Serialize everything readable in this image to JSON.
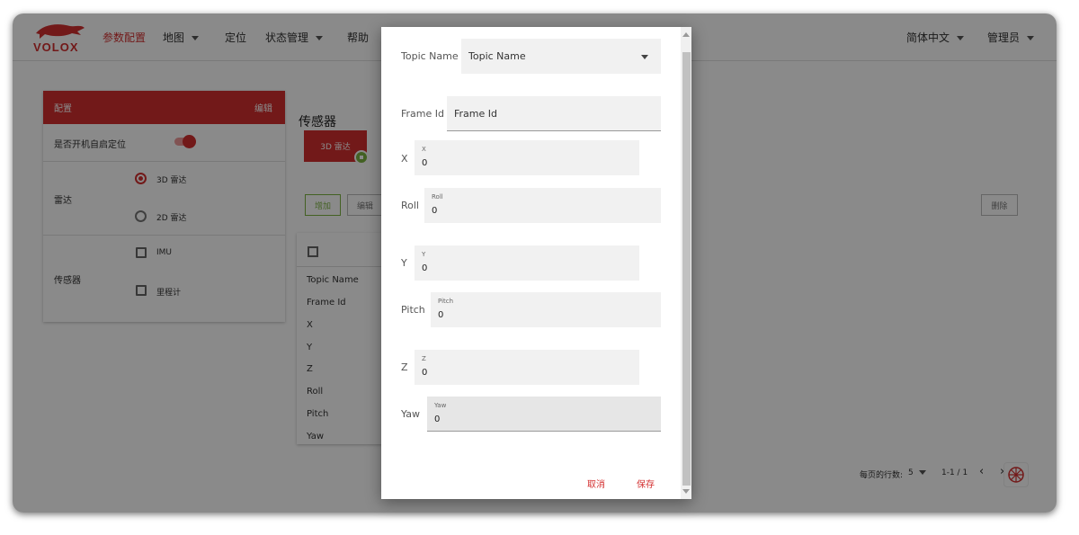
{
  "nav": {
    "logo_text": "VOLOX",
    "items": [
      {
        "label": "参数配置",
        "active": true
      },
      {
        "label": "地图",
        "dropdown": true
      },
      {
        "label": "定位"
      },
      {
        "label": "状态管理",
        "dropdown": true
      },
      {
        "label": "帮助"
      }
    ],
    "language": "简体中文",
    "user": "管理员"
  },
  "left_panel": {
    "header_title": "配置",
    "header_action": "编辑",
    "autostart_label": "是否开机自启定位",
    "autostart_on": true,
    "lidar_label": "雷达",
    "lidar_options": [
      "3D 雷达",
      "2D 雷达"
    ],
    "lidar_selected": "3D 雷达",
    "sensor_label": "传感器",
    "sensor_options": [
      "IMU",
      "里程计"
    ]
  },
  "main": {
    "title": "传感器",
    "tab_label": "3D 雷达",
    "add_button": "增加",
    "edit_button": "编辑",
    "delete_button": "删除",
    "table_rows": [
      "Topic Name",
      "Frame Id",
      "X",
      "Y",
      "Z",
      "Roll",
      "Pitch",
      "Yaw"
    ],
    "pagination": {
      "rows_per_page_label": "每页的行数:",
      "rows_per_page": "5",
      "range": "1-1 / 1"
    }
  },
  "dialog": {
    "topic_name": {
      "label": "Topic Name",
      "value": "Topic Name"
    },
    "frame_id": {
      "label": "Frame Id",
      "value": "Frame Id"
    },
    "x": {
      "label": "X",
      "hint": "X",
      "value": "0"
    },
    "roll": {
      "label": "Roll",
      "hint": "Roll",
      "value": "0"
    },
    "y": {
      "label": "Y",
      "hint": "Y",
      "value": "0"
    },
    "pitch": {
      "label": "Pitch",
      "hint": "Pitch",
      "value": "0"
    },
    "z": {
      "label": "Z",
      "hint": "Z",
      "value": "0"
    },
    "yaw": {
      "label": "Yaw",
      "hint": "Yaw",
      "value": "0"
    },
    "cancel": "取消",
    "save": "保存"
  },
  "colors": {
    "accent": "#d32f2f",
    "success": "#7cb342"
  },
  "icons": [
    "volox-logo-icon",
    "chevron-down-icon",
    "chevron-left-icon",
    "chevron-right-icon",
    "settings-fab-icon",
    "scroll-up-icon",
    "scroll-down-icon"
  ]
}
